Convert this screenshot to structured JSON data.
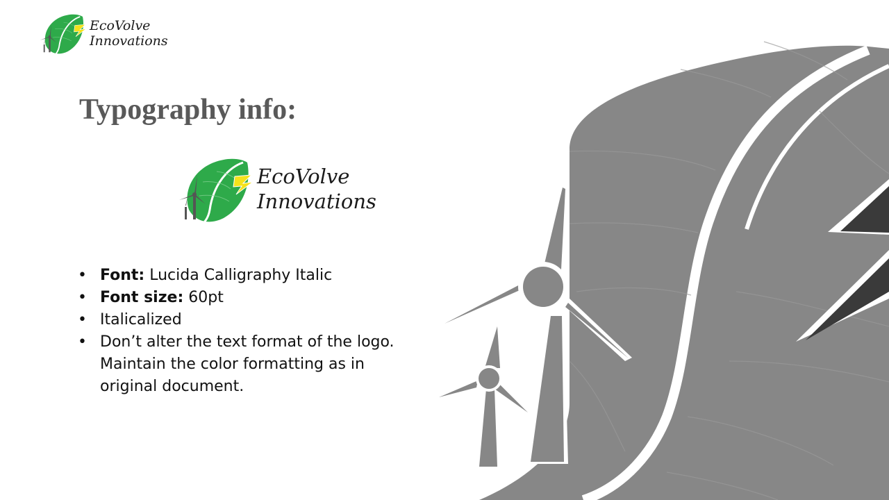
{
  "header_logo": {
    "line1": "EcoVolve",
    "line2": "Innovations"
  },
  "title": "Typography info:",
  "center_logo": {
    "line1": "EcoVolve",
    "line2": "Innovations"
  },
  "bullets": [
    {
      "label": "Font:",
      "text": " Lucida Calligraphy Italic"
    },
    {
      "label": "Font size:",
      "text": " 60pt"
    },
    {
      "label": "",
      "text": "Italicalized"
    },
    {
      "label": "",
      "text": "Don’t alter the text format of the logo. Maintain the color formatting as in original document."
    }
  ],
  "colors": {
    "title": "#595959",
    "leaf_green": "#2eaa4a",
    "bolt_yellow": "#f5e21b",
    "bg_graphic_gray": "#878787"
  },
  "icons": [
    "leaf-logo-icon",
    "wind-turbine-icon",
    "lightning-bolt-icon"
  ]
}
